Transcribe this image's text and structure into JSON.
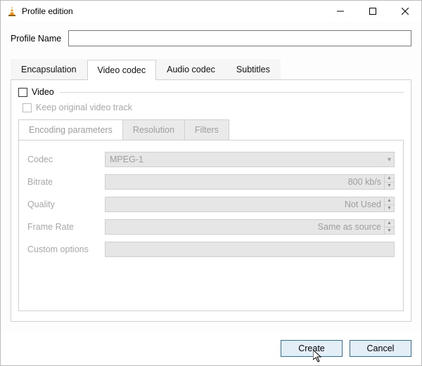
{
  "window": {
    "title": "Profile edition"
  },
  "profile": {
    "label": "Profile Name",
    "value": ""
  },
  "top_tabs": {
    "encapsulation": "Encapsulation",
    "video_codec": "Video codec",
    "audio_codec": "Audio codec",
    "subtitles": "Subtitles",
    "active": "video_codec"
  },
  "video_group": {
    "legend": "Video",
    "checked": false,
    "keep_original": {
      "label": "Keep original video track",
      "checked": false
    }
  },
  "sub_tabs": {
    "encoding": "Encoding parameters",
    "resolution": "Resolution",
    "filters": "Filters",
    "active": "encoding"
  },
  "fields": {
    "codec": {
      "label": "Codec",
      "value": "MPEG-1"
    },
    "bitrate": {
      "label": "Bitrate",
      "value": "800 kb/s"
    },
    "quality": {
      "label": "Quality",
      "value": "Not Used"
    },
    "frame_rate": {
      "label": "Frame Rate",
      "value": "Same as source"
    },
    "custom": {
      "label": "Custom options",
      "value": ""
    }
  },
  "buttons": {
    "create": "Create",
    "cancel": "Cancel"
  },
  "colors": {
    "window_border": "#bcbcbc",
    "disabled_text": "#9d9d9d",
    "disabled_bg": "#e6e6e6",
    "primary_border": "#2a6fb0",
    "primary_bg": "#e4eef7"
  }
}
